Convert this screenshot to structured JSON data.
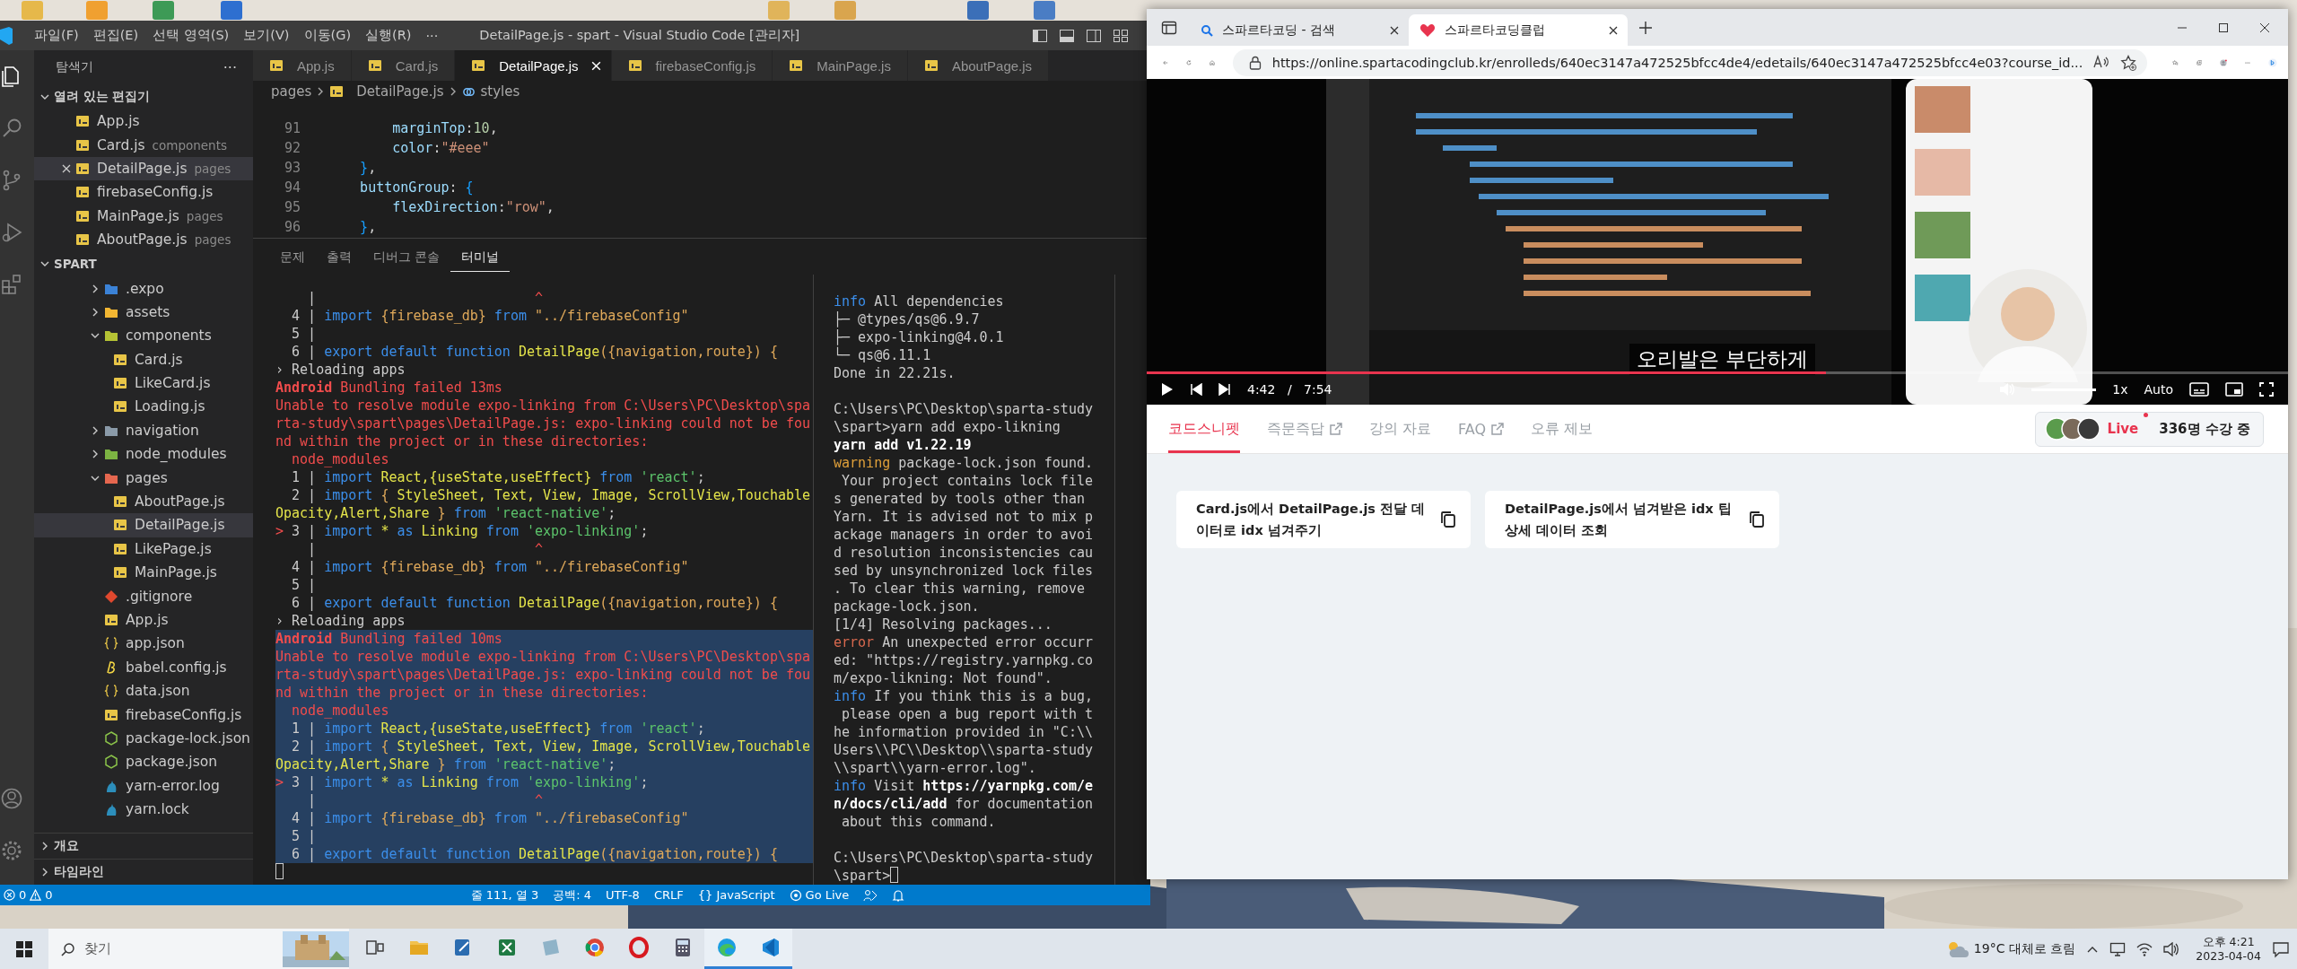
{
  "vscode": {
    "title": "DetailPage.js - spart - Visual Studio Code [관리자]",
    "menu": [
      "파일(F)",
      "편집(E)",
      "선택 영역(S)",
      "보기(V)",
      "이동(G)",
      "실행(R)",
      "···"
    ],
    "activity": [
      {
        "kind": "explorer",
        "selected": true
      },
      {
        "kind": "search",
        "selected": false
      },
      {
        "kind": "source-control",
        "selected": false
      },
      {
        "kind": "run",
        "selected": false
      },
      {
        "kind": "extensions",
        "selected": false
      },
      {
        "kind": "account",
        "selected": false
      },
      {
        "kind": "settings",
        "selected": false
      }
    ],
    "sidebar": {
      "title": "탐색기",
      "more": "···",
      "open_editors": {
        "title": "열려 있는 편집기",
        "expanded": true,
        "items": [
          {
            "name": "App.js",
            "selected": false
          },
          {
            "name": "Card.js",
            "dir": "components",
            "selected": false
          },
          {
            "name": "DetailPage.js",
            "dir": "pages",
            "selected": true
          },
          {
            "name": "firebaseConfig.js",
            "selected": false
          },
          {
            "name": "MainPage.js",
            "dir": "pages",
            "selected": false
          },
          {
            "name": "AboutPage.js",
            "dir": "pages",
            "selected": false
          }
        ]
      },
      "folder": {
        "title": "SPART",
        "expanded": true,
        "items": [
          {
            "name": ".expo",
            "kind": "folder",
            "color": "#3b82d6",
            "expanded": false,
            "selected": false
          },
          {
            "name": "assets",
            "kind": "folder",
            "color": "#f2b632",
            "expanded": false,
            "selected": false
          },
          {
            "name": "components",
            "kind": "folder",
            "color": "#b5c334",
            "expanded": true,
            "selected": false,
            "children": [
              {
                "name": "Card.js",
                "kind": "js",
                "selected": false
              },
              {
                "name": "LikeCard.js",
                "kind": "js",
                "selected": false
              },
              {
                "name": "Loading.js",
                "kind": "js",
                "selected": false
              }
            ]
          },
          {
            "name": "navigation",
            "kind": "folder",
            "color": "#8a9aa8",
            "expanded": false,
            "selected": false
          },
          {
            "name": "node_modules",
            "kind": "folder",
            "color": "#7cb342",
            "expanded": false,
            "selected": false
          },
          {
            "name": "pages",
            "kind": "folder",
            "color": "#e5674f",
            "expanded": true,
            "selected": false,
            "children": [
              {
                "name": "AboutPage.js",
                "kind": "js",
                "selected": false
              },
              {
                "name": "DetailPage.js",
                "kind": "js",
                "selected": true
              },
              {
                "name": "LikePage.js",
                "kind": "js",
                "selected": false
              },
              {
                "name": "MainPage.js",
                "kind": "js",
                "selected": false
              }
            ]
          },
          {
            "name": ".gitignore",
            "kind": "git",
            "selected": false
          },
          {
            "name": "App.js",
            "kind": "js",
            "selected": false
          },
          {
            "name": "app.json",
            "kind": "json",
            "selected": false
          },
          {
            "name": "babel.config.js",
            "kind": "babel",
            "selected": false
          },
          {
            "name": "data.json",
            "kind": "json",
            "selected": false
          },
          {
            "name": "firebaseConfig.js",
            "kind": "js",
            "selected": false
          },
          {
            "name": "package-lock.json",
            "kind": "npm",
            "selected": false
          },
          {
            "name": "package.json",
            "kind": "npm",
            "selected": false
          },
          {
            "name": "yarn-error.log",
            "kind": "yarn",
            "selected": false
          },
          {
            "name": "yarn.lock",
            "kind": "yarn",
            "selected": false
          }
        ]
      },
      "sections": [
        {
          "title": "개요",
          "expanded": false
        },
        {
          "title": "타임라인",
          "expanded": false
        }
      ]
    },
    "tabs": [
      {
        "label": "App.js",
        "selected": false
      },
      {
        "label": "Card.js",
        "selected": false
      },
      {
        "label": "DetailPage.js",
        "selected": true
      },
      {
        "label": "firebaseConfig.js",
        "selected": false
      },
      {
        "label": "MainPage.js",
        "selected": false
      },
      {
        "label": "AboutPage.js",
        "selected": false
      }
    ],
    "breadcrumb": [
      {
        "label": "pages",
        "kind": "folder"
      },
      {
        "label": "DetailPage.js",
        "kind": "file"
      },
      {
        "label": "styles",
        "kind": "symbol"
      }
    ],
    "code": [
      {
        "number": "91",
        "segments": [
          {
            "text": "        marginTop",
            "kind": "prop"
          },
          {
            "text": ":",
            "kind": "punct"
          },
          {
            "text": "10",
            "kind": "num"
          },
          {
            "text": ",",
            "kind": "punct"
          }
        ]
      },
      {
        "number": "92",
        "segments": [
          {
            "text": "        color",
            "kind": "prop"
          },
          {
            "text": ":",
            "kind": "punct"
          },
          {
            "text": "\"#eee\"",
            "kind": "estr"
          }
        ]
      },
      {
        "number": "93",
        "segments": [
          {
            "text": "    }",
            "kind": "bracket"
          },
          {
            "text": ",",
            "kind": "punct"
          }
        ]
      },
      {
        "number": "94",
        "segments": [
          {
            "text": "    buttonGroup",
            "kind": "prop"
          },
          {
            "text": ": ",
            "kind": "punct"
          },
          {
            "text": "{",
            "kind": "bracket"
          }
        ]
      },
      {
        "number": "95",
        "segments": [
          {
            "text": "        flexDirection",
            "kind": "prop"
          },
          {
            "text": ":",
            "kind": "punct"
          },
          {
            "text": "\"row\"",
            "kind": "estr"
          },
          {
            "text": ",",
            "kind": "punct"
          }
        ]
      },
      {
        "number": "96",
        "segments": [
          {
            "text": "    }",
            "kind": "bracket"
          },
          {
            "text": ",",
            "kind": "punct"
          }
        ]
      }
    ],
    "panel": {
      "tabs": [
        {
          "label": "문제",
          "selected": false
        },
        {
          "label": "출력",
          "selected": false
        },
        {
          "label": "디버그 콘솔",
          "selected": false
        },
        {
          "label": "터미널",
          "selected": true
        }
      ],
      "terminals": [
        {
          "cursor": true,
          "lines": [
            {
              "selected": false,
              "segments": [
                {
                  "text": "    |",
                  "kind": "plain"
                },
                {
                  "text": "                           ^",
                  "kind": "err"
                }
              ]
            },
            {
              "selected": false,
              "segments": [
                {
                  "text": "  4 | ",
                  "kind": "plain"
                },
                {
                  "text": "import",
                  "kind": "kw"
                },
                {
                  "text": " {firebase_db} ",
                  "kind": "brace"
                },
                {
                  "text": "from",
                  "kind": "kw"
                },
                {
                  "text": " \"../firebaseConfig\"",
                  "kind": "brace"
                }
              ]
            },
            {
              "selected": false,
              "segments": [
                {
                  "text": "  5 |",
                  "kind": "plain"
                }
              ]
            },
            {
              "selected": false,
              "segments": [
                {
                  "text": "  6 | ",
                  "kind": "plain"
                },
                {
                  "text": "export default function ",
                  "kind": "kw"
                },
                {
                  "text": "DetailPage",
                  "kind": "id"
                },
                {
                  "text": "({navigation,route}) {",
                  "kind": "brace"
                }
              ]
            },
            {
              "selected": false,
              "segments": [
                {
                  "text": "› Reloading apps",
                  "kind": "plain"
                }
              ]
            },
            {
              "selected": false,
              "segments": [
                {
                  "text": "Android",
                  "kind": "errb"
                },
                {
                  "text": " Bundling failed 13ms",
                  "kind": "err"
                }
              ]
            },
            {
              "selected": false,
              "segments": [
                {
                  "text": "Unable to resolve module expo-linking from C:\\Users\\PC\\Desktop\\spa",
                  "kind": "err"
                }
              ]
            },
            {
              "selected": false,
              "segments": [
                {
                  "text": "rta-study\\spart\\pages\\DetailPage.js: expo-linking could not be fou",
                  "kind": "err"
                }
              ]
            },
            {
              "selected": false,
              "segments": [
                {
                  "text": "nd within the project or in these directories:",
                  "kind": "err"
                }
              ]
            },
            {
              "selected": false,
              "segments": [
                {
                  "text": "  node_modules",
                  "kind": "err"
                }
              ]
            },
            {
              "selected": false,
              "segments": [
                {
                  "text": "  1 | ",
                  "kind": "plain"
                },
                {
                  "text": "import",
                  "kind": "kw"
                },
                {
                  "text": " React,{useState,useEffect} ",
                  "kind": "id"
                },
                {
                  "text": "from",
                  "kind": "kw"
                },
                {
                  "text": " 'react'",
                  "kind": "str"
                },
                {
                  "text": ";",
                  "kind": "plain"
                }
              ]
            },
            {
              "selected": false,
              "segments": [
                {
                  "text": "  2 | ",
                  "kind": "plain"
                },
                {
                  "text": "import",
                  "kind": "kw"
                },
                {
                  "text": " { ",
                  "kind": "brace"
                },
                {
                  "text": "StyleSheet, Text, View, Image, ScrollView,Touchable",
                  "kind": "id"
                }
              ]
            },
            {
              "selected": false,
              "segments": [
                {
                  "text": "Opacity,Alert,Share",
                  "kind": "id"
                },
                {
                  "text": " } ",
                  "kind": "brace"
                },
                {
                  "text": "from",
                  "kind": "kw"
                },
                {
                  "text": " 'react-native'",
                  "kind": "str"
                },
                {
                  "text": ";",
                  "kind": "plain"
                }
              ]
            },
            {
              "selected": false,
              "segments": [
                {
                  "text": ">",
                  "kind": "err"
                },
                {
                  "text": " 3 | ",
                  "kind": "plain"
                },
                {
                  "text": "import",
                  "kind": "kw"
                },
                {
                  "text": " * ",
                  "kind": "id"
                },
                {
                  "text": "as",
                  "kind": "kw"
                },
                {
                  "text": " Linking ",
                  "kind": "id"
                },
                {
                  "text": "from",
                  "kind": "kw"
                },
                {
                  "text": " 'expo-linking'",
                  "kind": "str"
                },
                {
                  "text": ";",
                  "kind": "plain"
                }
              ]
            },
            {
              "selected": false,
              "segments": [
                {
                  "text": "    |",
                  "kind": "plain"
                },
                {
                  "text": "                           ^",
                  "kind": "err"
                }
              ]
            },
            {
              "selected": false,
              "segments": [
                {
                  "text": "  4 | ",
                  "kind": "plain"
                },
                {
                  "text": "import",
                  "kind": "kw"
                },
                {
                  "text": " {firebase_db} ",
                  "kind": "brace"
                },
                {
                  "text": "from",
                  "kind": "kw"
                },
                {
                  "text": " \"../firebaseConfig\"",
                  "kind": "brace"
                }
              ]
            },
            {
              "selected": false,
              "segments": [
                {
                  "text": "  5 |",
                  "kind": "plain"
                }
              ]
            },
            {
              "selected": false,
              "segments": [
                {
                  "text": "  6 | ",
                  "kind": "plain"
                },
                {
                  "text": "export default function ",
                  "kind": "kw"
                },
                {
                  "text": "DetailPage",
                  "kind": "id"
                },
                {
                  "text": "({navigation,route}) {",
                  "kind": "brace"
                }
              ]
            },
            {
              "selected": false,
              "segments": [
                {
                  "text": "› Reloading apps",
                  "kind": "plain"
                }
              ]
            },
            {
              "selected": true,
              "segments": [
                {
                  "text": "Android",
                  "kind": "errb"
                },
                {
                  "text": " Bundling failed 10ms",
                  "kind": "err"
                }
              ]
            },
            {
              "selected": true,
              "segments": [
                {
                  "text": "Unable to resolve module expo-linking from C:\\Users\\PC\\Desktop\\spa",
                  "kind": "err"
                }
              ]
            },
            {
              "selected": true,
              "segments": [
                {
                  "text": "rta-study\\spart\\pages\\DetailPage.js: expo-linking could not be fou",
                  "kind": "err"
                }
              ]
            },
            {
              "selected": true,
              "segments": [
                {
                  "text": "nd within the project or in these directories:",
                  "kind": "err"
                }
              ]
            },
            {
              "selected": true,
              "segments": [
                {
                  "text": "  node_modules",
                  "kind": "err"
                }
              ]
            },
            {
              "selected": true,
              "segments": [
                {
                  "text": "  1 | ",
                  "kind": "plain"
                },
                {
                  "text": "import",
                  "kind": "kw"
                },
                {
                  "text": " React,{useState,useEffect} ",
                  "kind": "id"
                },
                {
                  "text": "from",
                  "kind": "kw"
                },
                {
                  "text": " 'react'",
                  "kind": "str"
                },
                {
                  "text": ";",
                  "kind": "plain"
                }
              ]
            },
            {
              "selected": true,
              "segments": [
                {
                  "text": "  2 | ",
                  "kind": "plain"
                },
                {
                  "text": "import",
                  "kind": "kw"
                },
                {
                  "text": " { ",
                  "kind": "brace"
                },
                {
                  "text": "StyleSheet, Text, View, Image, ScrollView,Touchable",
                  "kind": "id"
                }
              ]
            },
            {
              "selected": true,
              "segments": [
                {
                  "text": "Opacity,Alert,Share",
                  "kind": "id"
                },
                {
                  "text": " } ",
                  "kind": "brace"
                },
                {
                  "text": "from",
                  "kind": "kw"
                },
                {
                  "text": " 'react-native'",
                  "kind": "str"
                },
                {
                  "text": ";",
                  "kind": "plain"
                }
              ]
            },
            {
              "selected": true,
              "segments": [
                {
                  "text": ">",
                  "kind": "err"
                },
                {
                  "text": " 3 | ",
                  "kind": "plain"
                },
                {
                  "text": "import",
                  "kind": "kw"
                },
                {
                  "text": " * ",
                  "kind": "id"
                },
                {
                  "text": "as",
                  "kind": "kw"
                },
                {
                  "text": " Linking ",
                  "kind": "id"
                },
                {
                  "text": "from",
                  "kind": "kw"
                },
                {
                  "text": " 'expo-linking'",
                  "kind": "str"
                },
                {
                  "text": ";",
                  "kind": "plain"
                }
              ]
            },
            {
              "selected": true,
              "segments": [
                {
                  "text": "    |",
                  "kind": "plain"
                },
                {
                  "text": "                           ^",
                  "kind": "err"
                }
              ]
            },
            {
              "selected": true,
              "segments": [
                {
                  "text": "  4 | ",
                  "kind": "plain"
                },
                {
                  "text": "import",
                  "kind": "kw"
                },
                {
                  "text": " {firebase_db} ",
                  "kind": "brace"
                },
                {
                  "text": "from",
                  "kind": "kw"
                },
                {
                  "text": " \"../firebaseConfig\"",
                  "kind": "brace"
                }
              ]
            },
            {
              "selected": true,
              "segments": [
                {
                  "text": "  5 |",
                  "kind": "plain"
                }
              ]
            },
            {
              "selected": true,
              "segments": [
                {
                  "text": "  6 | ",
                  "kind": "plain"
                },
                {
                  "text": "export default function ",
                  "kind": "kw"
                },
                {
                  "text": "DetailPage",
                  "kind": "id"
                },
                {
                  "text": "({navigation,route}) {",
                  "kind": "brace"
                }
              ]
            },
            {
              "kind": "blank"
            }
          ]
        },
        {
          "cursor": true,
          "lines": [
            {
              "kind": "text",
              "segments": [
                {
                  "text": "info",
                  "kind": "info"
                },
                {
                  "text": " All dependencies",
                  "kind": "plain"
                }
              ]
            },
            {
              "kind": "text",
              "segments": [
                {
                  "text": "├─ @types/qs@6.9.7",
                  "kind": "plain"
                }
              ]
            },
            {
              "kind": "text",
              "segments": [
                {
                  "text": "├─ expo-linking@4.0.1",
                  "kind": "plain"
                }
              ]
            },
            {
              "kind": "text",
              "segments": [
                {
                  "text": "└─ qs@6.11.1",
                  "kind": "plain"
                }
              ]
            },
            {
              "kind": "text",
              "segments": [
                {
                  "text": "Done in 22.21s.",
                  "kind": "plain"
                }
              ]
            },
            {
              "kind": "blank"
            },
            {
              "kind": "text",
              "segments": [
                {
                  "text": "C:\\Users\\PC\\Desktop\\sparta-study",
                  "kind": "plain"
                }
              ]
            },
            {
              "kind": "text",
              "segments": [
                {
                  "text": "\\spart>yarn add expo-likning",
                  "kind": "plain"
                }
              ]
            },
            {
              "kind": "text",
              "segments": [
                {
                  "text": "yarn add v1.22.19",
                  "kind": "bold"
                }
              ]
            },
            {
              "kind": "text",
              "segments": [
                {
                  "text": "warning",
                  "kind": "warn"
                },
                {
                  "text": " package-lock.json found.",
                  "kind": "plain"
                }
              ]
            },
            {
              "kind": "text",
              "segments": [
                {
                  "text": " Your project contains lock file",
                  "kind": "plain"
                }
              ]
            },
            {
              "kind": "text",
              "segments": [
                {
                  "text": "s generated by tools other than",
                  "kind": "plain"
                }
              ]
            },
            {
              "kind": "text",
              "segments": [
                {
                  "text": "Yarn. It is advised not to mix p",
                  "kind": "plain"
                }
              ]
            },
            {
              "kind": "text",
              "segments": [
                {
                  "text": "ackage managers in order to avoi",
                  "kind": "plain"
                }
              ]
            },
            {
              "kind": "text",
              "segments": [
                {
                  "text": "d resolution inconsistencies cau",
                  "kind": "plain"
                }
              ]
            },
            {
              "kind": "text",
              "segments": [
                {
                  "text": "sed by unsynchronized lock files",
                  "kind": "plain"
                }
              ]
            },
            {
              "kind": "text",
              "segments": [
                {
                  "text": ". To clear this warning, remove",
                  "kind": "plain"
                }
              ]
            },
            {
              "kind": "text",
              "segments": [
                {
                  "text": "package-lock.json.",
                  "kind": "plain"
                }
              ]
            },
            {
              "kind": "text",
              "segments": [
                {
                  "text": "[1/4] Resolving packages...",
                  "kind": "plain"
                }
              ]
            },
            {
              "kind": "text",
              "segments": [
                {
                  "text": "error",
                  "kind": "errl"
                },
                {
                  "text": " An unexpected error occurr",
                  "kind": "plain"
                }
              ]
            },
            {
              "kind": "text",
              "segments": [
                {
                  "text": "ed: \"https://registry.yarnpkg.co",
                  "kind": "plain"
                }
              ]
            },
            {
              "kind": "text",
              "segments": [
                {
                  "text": "m/expo-likning: Not found\".",
                  "kind": "plain"
                }
              ]
            },
            {
              "kind": "text",
              "segments": [
                {
                  "text": "info",
                  "kind": "info"
                },
                {
                  "text": " If you think this is a bug,",
                  "kind": "plain"
                }
              ]
            },
            {
              "kind": "text",
              "segments": [
                {
                  "text": " please open a bug report with t",
                  "kind": "plain"
                }
              ]
            },
            {
              "kind": "text",
              "segments": [
                {
                  "text": "he information provided in \"C:\\\\",
                  "kind": "plain"
                }
              ]
            },
            {
              "kind": "text",
              "segments": [
                {
                  "text": "Users\\\\PC\\\\Desktop\\\\sparta-study",
                  "kind": "plain"
                }
              ]
            },
            {
              "kind": "text",
              "segments": [
                {
                  "text": "\\\\spart\\\\yarn-error.log\".",
                  "kind": "plain"
                }
              ]
            },
            {
              "kind": "text",
              "segments": [
                {
                  "text": "info",
                  "kind": "info"
                },
                {
                  "text": " Visit ",
                  "kind": "plain"
                },
                {
                  "text": "https://yarnpkg.com/e",
                  "kind": "bold"
                }
              ]
            },
            {
              "kind": "text",
              "segments": [
                {
                  "text": "n/docs/cli/add",
                  "kind": "bold"
                },
                {
                  "text": " for documentation",
                  "kind": "plain"
                }
              ]
            },
            {
              "kind": "text",
              "segments": [
                {
                  "text": " about this command.",
                  "kind": "plain"
                }
              ]
            },
            {
              "kind": "blank"
            },
            {
              "kind": "text",
              "segments": [
                {
                  "text": "C:\\Users\\PC\\Desktop\\sparta-study",
                  "kind": "plain"
                }
              ]
            },
            {
              "kind": "text",
              "segments": [
                {
                  "text": "\\spart>",
                  "kind": "plain"
                }
              ]
            }
          ]
        }
      ]
    },
    "status_bar": {
      "errors": "0",
      "warnings": "0",
      "items": [
        {
          "text": "줄 111, 열 3",
          "kind": "text"
        },
        {
          "text": "공백: 4",
          "kind": "text"
        },
        {
          "text": "UTF-8",
          "kind": "text"
        },
        {
          "text": "CRLF",
          "kind": "text"
        },
        {
          "text": "{} JavaScript",
          "kind": "text"
        },
        {
          "text": "Go Live",
          "kind": "live"
        },
        {
          "kind": "feedback"
        },
        {
          "kind": "bell"
        }
      ]
    }
  },
  "browser": {
    "tabs": [
      {
        "title": "스파르타코딩 - 검색",
        "kind": "search",
        "selected": false
      },
      {
        "title": "스파르타코딩클럽",
        "kind": "site",
        "selected": true
      }
    ],
    "url": "https://online.spartacodingclub.kr/enrolleds/640ec3147a472525bfcc4de4/edetails/640ec3147a472525bfcc4e03?course_id...",
    "video": {
      "kind": "picture",
      "caption": "오리발은 부단하게",
      "progress": {
        "level": 0.595
      },
      "time": "4:42 / 7:54",
      "volume": {
        "level": 1
      },
      "speed": "1x",
      "quality": "Auto"
    },
    "page_tabs": [
      {
        "label": "코드스니펫",
        "selected": true,
        "external": false
      },
      {
        "label": "즉문즉답",
        "selected": false,
        "external": true
      },
      {
        "label": "강의 자료",
        "selected": false,
        "external": false
      },
      {
        "label": "FAQ",
        "selected": false,
        "external": true
      },
      {
        "label": "오류 제보",
        "selected": false,
        "external": false
      }
    ],
    "live": {
      "label": "Live",
      "count": "336명 수강 중"
    },
    "snippets": [
      {
        "title": "Card.js에서 DetailPage.js 전달 데이터로 idx 넘겨주기"
      },
      {
        "title": "DetailPage.js에서 넘겨받은 idx 팁 상세 데이터 조회"
      }
    ]
  },
  "taskbar": {
    "search": {
      "placeholder": "찾기"
    },
    "apps": [
      {
        "kind": "task-view",
        "running": false
      },
      {
        "kind": "folder",
        "running": false
      },
      {
        "kind": "pen-document",
        "running": false
      },
      {
        "kind": "spreadsheet",
        "running": false
      },
      {
        "kind": "slate",
        "running": false
      },
      {
        "kind": "ring-browser",
        "running": false
      },
      {
        "kind": "red-ring",
        "running": false
      },
      {
        "kind": "calculator",
        "running": false
      },
      {
        "kind": "wave-browser",
        "running": true
      },
      {
        "kind": "code-editor",
        "running": true
      }
    ],
    "weather": "19°C 대체로 흐림",
    "clock": {
      "time": "오후 4:21",
      "date": "2023-04-04"
    }
  }
}
